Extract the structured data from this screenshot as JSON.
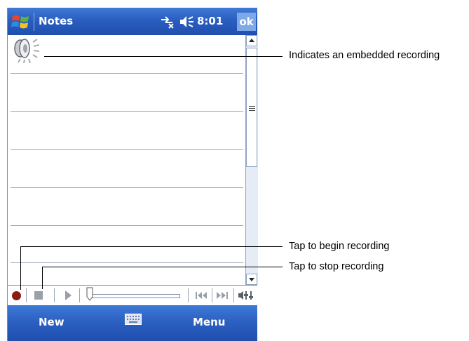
{
  "titlebar": {
    "app_title": "Notes",
    "clock": "8:01",
    "ok_label": "ok",
    "start_icon": "windows-flag-icon",
    "connectivity_icon": "connectivity-icon",
    "volume_icon": "speaker-volume-icon"
  },
  "note": {
    "recording_icon": "speaker-recording-icon"
  },
  "toolbar": {
    "record_icon": "record-icon",
    "stop_icon": "stop-icon",
    "play_icon": "play-icon",
    "position_slider": 0.0,
    "prev_icon": "skip-back-icon",
    "next_icon": "skip-forward-icon",
    "volume_icon": "volume-slider-icon"
  },
  "menubar": {
    "new_label": "New",
    "menu_label": "Menu",
    "keyboard_icon": "keyboard-icon"
  },
  "callouts": {
    "embedded": "Indicates an embedded recording",
    "begin": "Tap to begin recording",
    "stop": "Tap to stop recording"
  },
  "colors": {
    "titlebar_blue": "#2a5ec0",
    "record_red": "#8a1c14"
  }
}
